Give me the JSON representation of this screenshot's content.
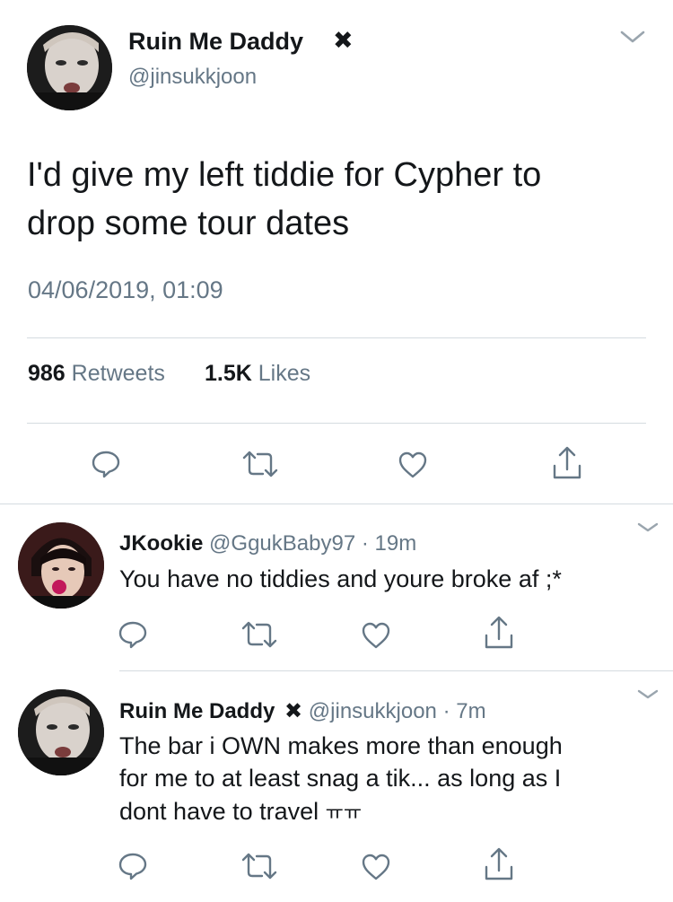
{
  "main_tweet": {
    "display_name": "Ruin Me Daddy",
    "name_mark": "✖",
    "handle": "@jinsukkjoon",
    "text_line1": "I'd give my left tiddie for Cypher to",
    "text_line2": "drop some tour dates",
    "timestamp": "04/06/2019, 01:09",
    "retweet_count": "986",
    "retweet_label": "Retweets",
    "like_count": "1.5K",
    "like_label": "Likes"
  },
  "replies": [
    {
      "display_name": "JKookie",
      "handle": "@GgukBaby97",
      "separator": "·",
      "time": "19m",
      "text_lines": [
        "You have no tiddies and youre broke af ;*"
      ]
    },
    {
      "display_name": "Ruin Me Daddy",
      "name_mark": "✖",
      "handle": "@jinsukkjoon",
      "separator": "·",
      "time": "7m",
      "text_lines": [
        "The bar i OWN makes more than enough",
        "for me to at least snag a tik... as long as I",
        "dont have to travel"
      ],
      "text_emoticon": "ㅠㅠ"
    }
  ],
  "icons": {
    "menu": "chevron-down-icon",
    "reply": "reply-icon",
    "retweet": "retweet-icon",
    "like": "heart-icon",
    "share": "share-icon"
  },
  "colors": {
    "text": "#14171a",
    "secondary": "#657786",
    "divider": "#d5dbe0"
  }
}
